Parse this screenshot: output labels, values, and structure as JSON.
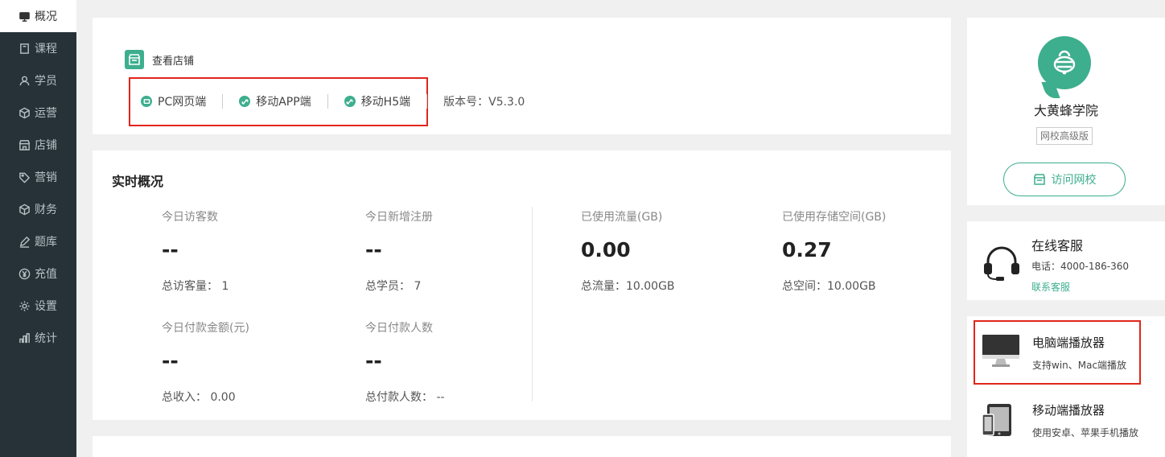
{
  "sidebar": {
    "items": [
      {
        "label": "概况",
        "icon": "dashboard-icon",
        "active": true
      },
      {
        "label": "课程",
        "icon": "book-icon"
      },
      {
        "label": "学员",
        "icon": "user-icon"
      },
      {
        "label": "运营",
        "icon": "cube-icon"
      },
      {
        "label": "店铺",
        "icon": "store-icon"
      },
      {
        "label": "营销",
        "icon": "tag-icon"
      },
      {
        "label": "财务",
        "icon": "cube-icon"
      },
      {
        "label": "题库",
        "icon": "pencil-icon"
      },
      {
        "label": "充值",
        "icon": "yen-icon"
      },
      {
        "label": "设置",
        "icon": "gear-icon"
      },
      {
        "label": "统计",
        "icon": "bar-chart-icon"
      }
    ]
  },
  "store": {
    "title": "查看店铺",
    "links": [
      {
        "label": "PC网页端",
        "icon": "monitor-icon"
      },
      {
        "label": "移动APP端",
        "icon": "link-icon"
      },
      {
        "label": "移动H5端",
        "icon": "link-icon"
      }
    ],
    "version": "版本号：V5.3.0"
  },
  "overview": {
    "title": "实时概况",
    "stats": [
      {
        "label": "今日访客数",
        "value": "--",
        "sub": "总访客量： 1"
      },
      {
        "label": "今日新增注册",
        "value": "--",
        "sub": "总学员： 7"
      },
      {
        "label": "已使用流量(GB)",
        "value": "0.00",
        "sub": "总流量：10.00GB"
      },
      {
        "label": "已使用存储空间(GB)",
        "value": "0.27",
        "sub": "总空间：10.00GB"
      },
      {
        "label": "今日付款金额(元)",
        "value": "--",
        "sub": "总收入： 0.00"
      },
      {
        "label": "今日付款人数",
        "value": "--",
        "sub": "总付款人数： --"
      }
    ]
  },
  "school": {
    "name": "大黄蜂学院",
    "edition": "网校高级版",
    "visit_label": "访问网校"
  },
  "service": {
    "title": "在线客服",
    "phone": "电话：4000-186-360",
    "link": "联系客服"
  },
  "players": {
    "pc_title": "电脑端播放器",
    "pc_sub": "支持win、Mac端播放",
    "mobile_title": "移动端播放器",
    "mobile_sub": "使用安卓、苹果手机播放"
  },
  "colors": {
    "accent": "#3dae8e",
    "sidebar_bg": "#263238",
    "highlight": "#e1251b"
  }
}
